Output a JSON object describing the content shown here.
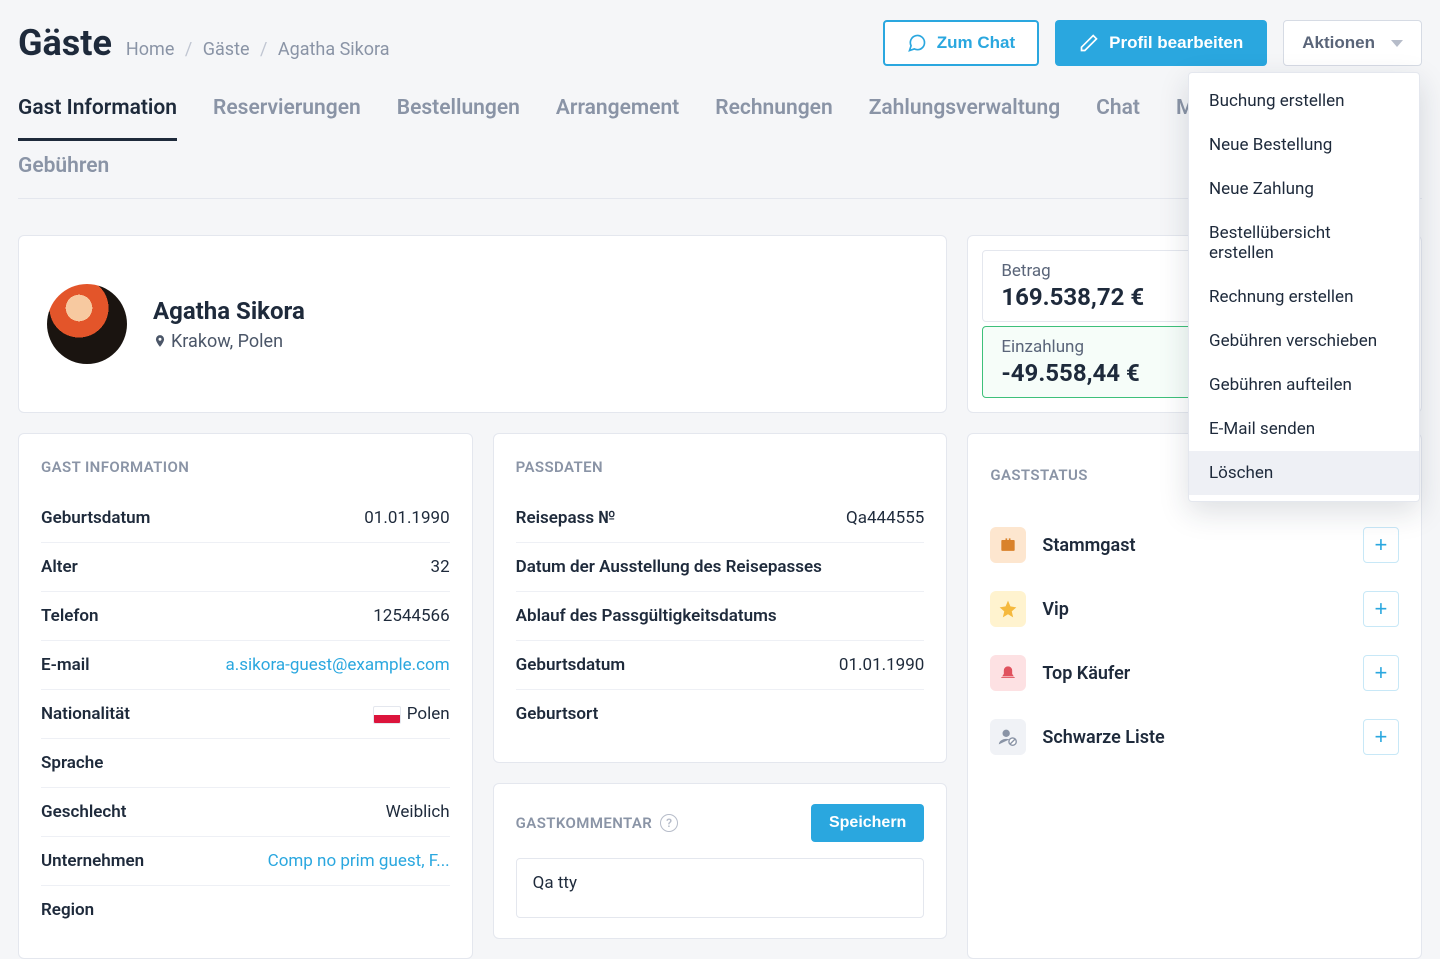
{
  "header": {
    "title": "Gäste",
    "breadcrumb": {
      "home": "Home",
      "guests": "Gäste",
      "current": "Agatha Sikora"
    },
    "buttons": {
      "chat": "Zum Chat",
      "edit_profile": "Profil bearbeiten",
      "actions": "Aktionen"
    }
  },
  "tabs": [
    "Gast Information",
    "Reservierungen",
    "Bestellungen",
    "Arrangement",
    "Rechnungen",
    "Zahlungsverwaltung",
    "Chat",
    "Moved charges",
    "Gebühren"
  ],
  "active_tab": "Gast Information",
  "dropdown": {
    "items": [
      "Buchung erstellen",
      "Neue Bestellung",
      "Neue Zahlung",
      "Bestellübersicht erstellen",
      "Rechnung erstellen",
      "Gebühren verschieben",
      "Gebühren aufteilen",
      "E-Mail senden",
      "Löschen"
    ],
    "hovered": "Löschen"
  },
  "profile": {
    "name": "Agatha Sikora",
    "location": "Krakow, Polen"
  },
  "amounts": {
    "betrag_label": "Betrag",
    "betrag_value": "169.538,72 €",
    "einzahlung_label": "Einzahlung",
    "einzahlung_value": "-49.558,44 €"
  },
  "guest_info": {
    "section_title": "GAST INFORMATION",
    "rows": {
      "birthdate": {
        "label": "Geburtsdatum",
        "value": "01.01.1990"
      },
      "age": {
        "label": "Alter",
        "value": "32"
      },
      "phone": {
        "label": "Telefon",
        "value": "12544566"
      },
      "email": {
        "label": "E-mail",
        "value": "a.sikora-guest@example.com"
      },
      "nationality": {
        "label": "Nationalität",
        "value": "Polen"
      },
      "language": {
        "label": "Sprache",
        "value": ""
      },
      "gender": {
        "label": "Geschlecht",
        "value": "Weiblich"
      },
      "company": {
        "label": "Unternehmen",
        "value": "Comp no prim guest, F..."
      },
      "region": {
        "label": "Region",
        "value": ""
      }
    }
  },
  "passport": {
    "section_title": "PASSDATEN",
    "rows": {
      "passno": {
        "label": "Reisepass №",
        "value": "Qa444555"
      },
      "issue": {
        "label": "Datum der Ausstellung des Reisepasses",
        "value": ""
      },
      "expiry": {
        "label": "Ablauf des Passgültigkeitsdatums",
        "value": ""
      },
      "birthdate": {
        "label": "Geburtsdatum",
        "value": "01.01.1990"
      },
      "birthplace": {
        "label": "Geburtsort",
        "value": ""
      }
    }
  },
  "comment": {
    "title": "GASTKOMMENTAR",
    "save": "Speichern",
    "text": "Qa tty"
  },
  "guest_status": {
    "title": "GASTSTATUS",
    "add_label": "hinzufügen",
    "items": [
      {
        "label": "Stammgast",
        "icon": "suitcase",
        "icon_class": "ic-stamm"
      },
      {
        "label": "Vip",
        "icon": "star",
        "icon_class": "ic-vip"
      },
      {
        "label": "Top Käufer",
        "icon": "bell",
        "icon_class": "ic-top"
      },
      {
        "label": "Schwarze Liste",
        "icon": "user-block",
        "icon_class": "ic-black"
      }
    ]
  }
}
